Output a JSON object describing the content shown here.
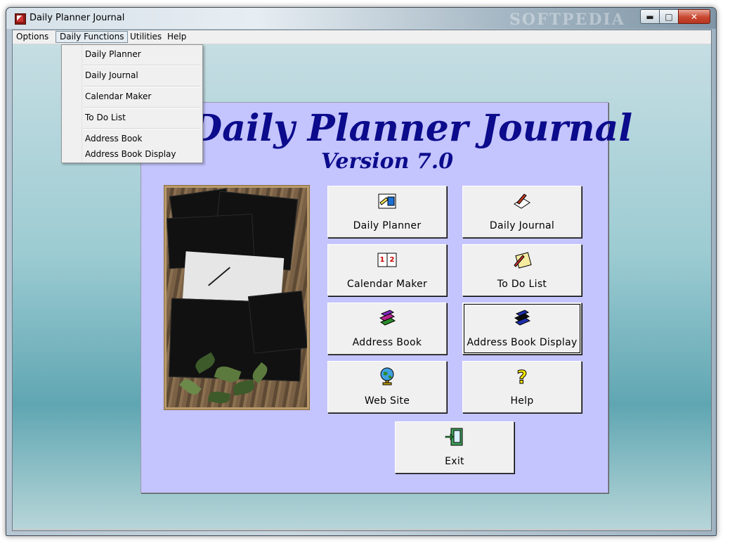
{
  "window": {
    "title": "Daily Planner Journal",
    "watermark": "SOFTPEDIA"
  },
  "menubar": {
    "items": [
      "Options",
      "Daily Functions",
      "Utilities",
      "Help"
    ]
  },
  "dropdown": {
    "items": [
      "Daily Planner",
      "Daily Journal",
      "Calendar Maker",
      "To Do List",
      "Address Book",
      "Address Book Display"
    ]
  },
  "panel": {
    "title": "Daily Planner Journal",
    "version": "Version 7.0"
  },
  "buttons": {
    "daily_planner": "Daily Planner",
    "daily_journal": "Daily Journal",
    "calendar_maker": "Calendar Maker",
    "to_do_list": "To Do List",
    "address_book": "Address Book",
    "address_book_display": "Address Book Display",
    "web_site": "Web Site",
    "help": "Help",
    "exit": "Exit"
  },
  "calendar_icon_digits": "1 2",
  "colors": {
    "title_blue": "#0b0b8c",
    "panel_lavender": "#c4c4fe"
  }
}
